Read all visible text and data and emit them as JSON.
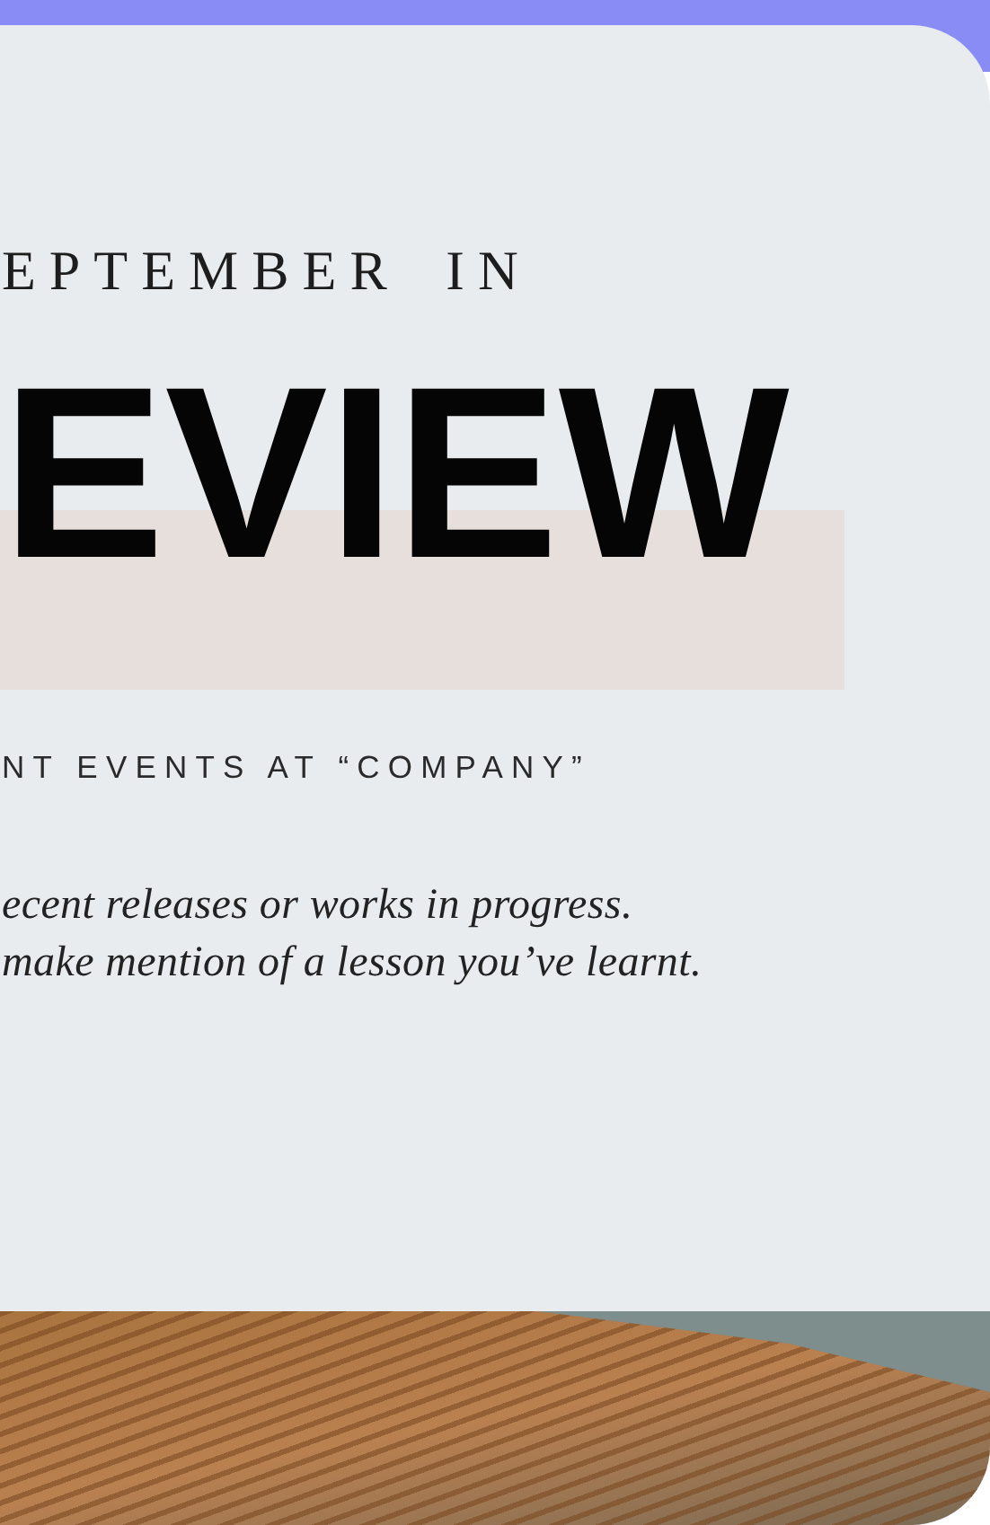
{
  "card": {
    "kicker": "EPTEMBER IN",
    "headline": "EVIEW",
    "subheading": "NT EVENTS AT “COMPANY”",
    "body_lines": [
      "ecent releases or works in progress.",
      "make mention of a lesson you’ve learnt."
    ]
  }
}
